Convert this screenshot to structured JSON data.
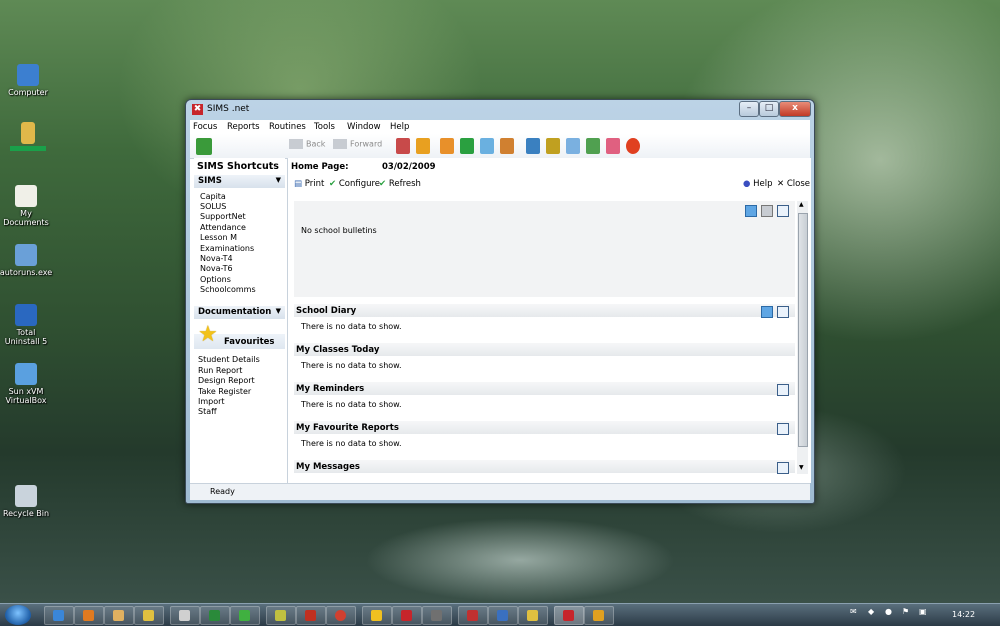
{
  "desktop": {
    "icons": [
      {
        "label": "Computer",
        "color": "#3c7fd0"
      },
      {
        "label": "",
        "color": "#e0b84a"
      },
      {
        "label": "My Documents",
        "color": "#f0f0e8"
      },
      {
        "label": "autoruns.exe",
        "color": "#6aa0d8"
      },
      {
        "label": "Total Uninstall 5",
        "color": "#2a68c0"
      },
      {
        "label": "Sun xVM VirtualBox",
        "color": "#5aa0e0"
      },
      {
        "label": "Recycle Bin",
        "color": "#c9d3dc"
      }
    ]
  },
  "window": {
    "title": "SIMS .net",
    "controls": {
      "minimize": "–",
      "maximize": "□",
      "close": "x"
    },
    "menu": [
      "Focus",
      "Reports",
      "Routines",
      "Tools",
      "Window",
      "Help"
    ],
    "toolbar": {
      "back": "Back",
      "forward": "Forward"
    },
    "shortcuts": {
      "title": "SIMS Shortcuts",
      "sims_section": "SIMS",
      "sims_items": [
        "Capita",
        "SOLUS",
        "SupportNet",
        "Attendance",
        "Lesson M",
        "Examinations",
        "Nova-T4",
        "Nova-T6",
        "Options",
        "Schoolcomms"
      ],
      "documentation_section": "Documentation",
      "favourites_section": "Favourites",
      "favourites_items": [
        "Student Details",
        "Run Report",
        "Design Report",
        "Take Register",
        "Import",
        "Staff"
      ]
    },
    "home": {
      "label": "Home Page:",
      "date": "03/02/2009",
      "actions": {
        "print": "Print",
        "configure": "Configure",
        "refresh": "Refresh",
        "help": "Help",
        "close": "Close"
      },
      "bulletin": "No school bulletins",
      "sections": [
        {
          "title": "School Diary",
          "text": "There is no data to show."
        },
        {
          "title": "My Classes Today",
          "text": "There is no data to show."
        },
        {
          "title": "My Reminders",
          "text": "There is no data to show."
        },
        {
          "title": "My Favourite Reports",
          "text": "There is no data to show."
        },
        {
          "title": "My Messages",
          "text": ""
        }
      ]
    },
    "status": "Ready"
  },
  "taskbar": {
    "clock": "14:22"
  }
}
